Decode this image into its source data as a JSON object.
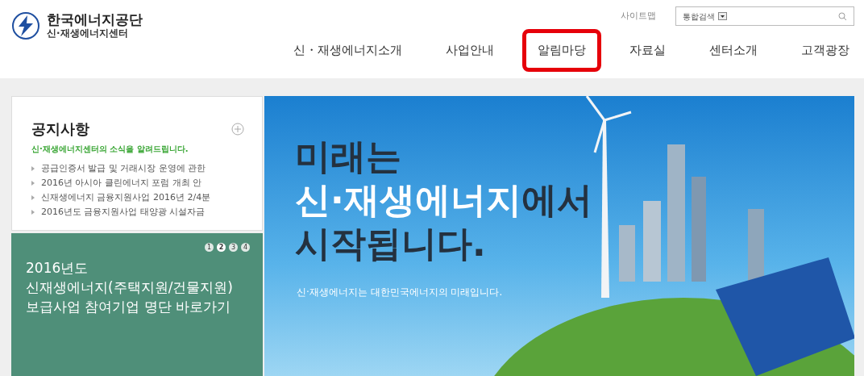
{
  "logo": {
    "title": "한국에너지공단",
    "subtitle": "신·재생에너지센터"
  },
  "utility": {
    "sitemap": "사이트맵",
    "search_scope": "통합검색"
  },
  "nav": [
    {
      "label": "신・재생에너지소개",
      "selected": false
    },
    {
      "label": "사업안내",
      "selected": false
    },
    {
      "label": "알림마당",
      "selected": true
    },
    {
      "label": "자료실",
      "selected": false
    },
    {
      "label": "센터소개",
      "selected": false
    },
    {
      "label": "고객광장",
      "selected": false
    }
  ],
  "notice": {
    "title": "공지사항",
    "subtitle": "신·재생에너지센터의 소식을 알려드립니다.",
    "items": [
      "공급인증서 발급 및 거래시장 운영에 관한",
      "2016년 아시아 클린에너지 포럼 개최 안",
      "신재생에너지 금융지원사업 2016년 2/4분",
      "2016년도 금융지원사업 태양광 시설자금"
    ]
  },
  "promo": {
    "pages": [
      {
        "label": "1",
        "selected": false
      },
      {
        "label": "2",
        "selected": true
      },
      {
        "label": "3",
        "selected": false
      },
      {
        "label": "4",
        "selected": false
      }
    ],
    "lines": [
      "2016년도",
      "신재생에너지(주택지원/건물지원)",
      "보급사업 참여기업 명단 바로가기"
    ]
  },
  "banner": {
    "headline": [
      [
        {
          "text": "미래는",
          "highlight": false
        }
      ],
      [
        {
          "text": "신·재생에너지",
          "highlight": true
        },
        {
          "text": "에서",
          "highlight": false
        }
      ],
      [
        {
          "text": "시작됩니다.",
          "highlight": false
        }
      ]
    ],
    "caption": "신·재생에너지는 대한민국에너지의 미래입니다."
  }
}
